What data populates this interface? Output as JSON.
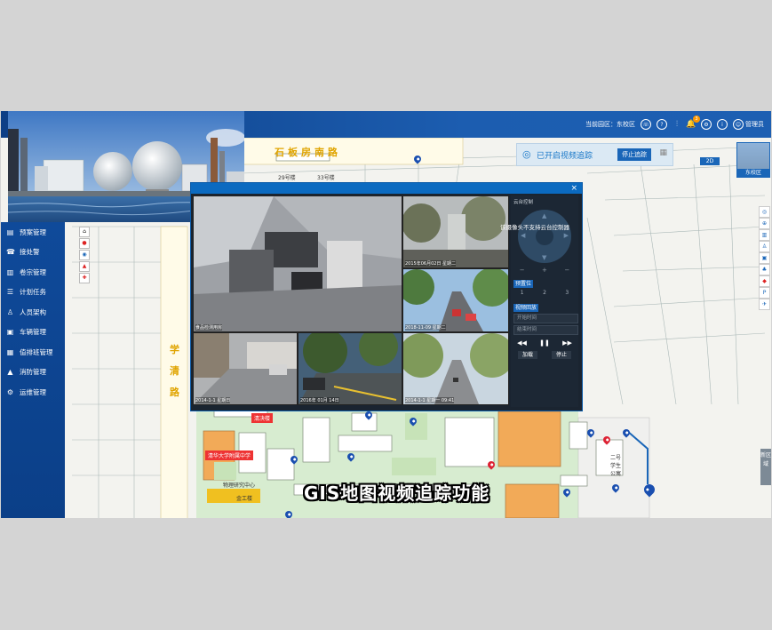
{
  "topbar": {
    "campus_label": "当前园区：",
    "campus_value": "东校区",
    "notification_count": "3",
    "user_label": "管理员"
  },
  "sidebar": {
    "items": [
      {
        "label": "预案管理",
        "icon": "document-icon"
      },
      {
        "label": "接处警",
        "icon": "alarm-icon"
      },
      {
        "label": "卷宗管理",
        "icon": "folder-icon"
      },
      {
        "label": "计划任务",
        "icon": "list-icon"
      },
      {
        "label": "人员架构",
        "icon": "people-icon"
      },
      {
        "label": "车辆管理",
        "icon": "car-icon"
      },
      {
        "label": "值排班管理",
        "icon": "schedule-icon"
      },
      {
        "label": "消防管理",
        "icon": "fire-icon"
      },
      {
        "label": "运维管理",
        "icon": "gear-icon"
      }
    ]
  },
  "notice": {
    "text": "已开启视频追踪",
    "button": "停止追踪"
  },
  "view_toggle": {
    "mode": "2D",
    "campus_thumb": "东校区"
  },
  "map": {
    "road_top": "石板房南路",
    "road_left": [
      "学",
      "清",
      "路"
    ],
    "labels": {
      "building_top_1": "29号楼",
      "building_top_2": "33号楼",
      "yellow_1": "金工楼",
      "red_1": "清华大学附属中学",
      "red_2": "清决楼",
      "blue_1": "物理研究中心",
      "dorm": "二号学生公寓",
      "bottom_right": "新区"
    }
  },
  "dialog": {
    "close": "×",
    "cams": [
      {
        "caption": "食品检测用房"
      },
      {
        "caption": "2015年06月02日 星期二"
      },
      {
        "caption": "2014-1-1 星期日"
      },
      {
        "caption": "2016年 01月 14日"
      },
      {
        "caption": "2018-11-09 星期二"
      },
      {
        "caption": "2014-1-1 星期一 09:41"
      }
    ],
    "ptz": {
      "header": "云台控制",
      "message": "该摄像头不支持云台控制器",
      "preset_label": "预置位",
      "preset_nums": [
        "1",
        "2",
        "3"
      ],
      "playback_label": "视频回放",
      "start_time": "开始时间",
      "end_time": "结束时间",
      "load": "加载",
      "stop": "停止"
    }
  },
  "subtitle": "GIS地图视频追踪功能",
  "side_tab": "新区域"
}
